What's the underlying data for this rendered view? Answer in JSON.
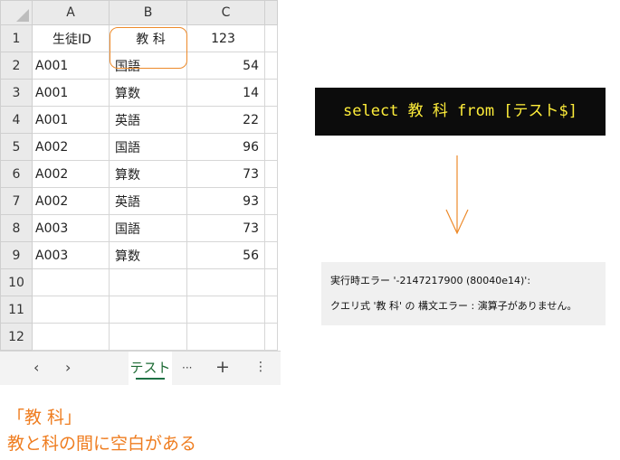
{
  "spreadsheet": {
    "columns": [
      "A",
      "B",
      "C"
    ],
    "rows": [
      {
        "num": "1",
        "a": "生徒ID",
        "b": "教 科",
        "c": "123"
      },
      {
        "num": "2",
        "a": "A001",
        "b": "国語",
        "c": "54"
      },
      {
        "num": "3",
        "a": "A001",
        "b": "算数",
        "c": "14"
      },
      {
        "num": "4",
        "a": "A001",
        "b": "英語",
        "c": "22"
      },
      {
        "num": "5",
        "a": "A002",
        "b": "国語",
        "c": "96"
      },
      {
        "num": "6",
        "a": "A002",
        "b": "算数",
        "c": "73"
      },
      {
        "num": "7",
        "a": "A002",
        "b": "英語",
        "c": "93"
      },
      {
        "num": "8",
        "a": "A003",
        "b": "国語",
        "c": "73"
      },
      {
        "num": "9",
        "a": "A003",
        "b": "算数",
        "c": "56"
      },
      {
        "num": "10",
        "a": "",
        "b": "",
        "c": ""
      },
      {
        "num": "11",
        "a": "",
        "b": "",
        "c": ""
      },
      {
        "num": "12",
        "a": "",
        "b": "",
        "c": ""
      }
    ],
    "tabbar": {
      "prev": "‹",
      "next": "›",
      "sheet_tab": "テスト",
      "more": "···",
      "add": "+",
      "options": "⋮"
    }
  },
  "sql": {
    "query": "select 教 科 from [テスト$]"
  },
  "error": {
    "line1": "実行時エラー '-2147217900 (80040e14)':",
    "line2": "クエリ式 '教 科' の 構文エラー : 演算子がありません。"
  },
  "caption": {
    "line1": "「教 科」",
    "line2": "教と科の間に空白がある"
  },
  "colors": {
    "highlight": "#ed8a2a",
    "caption": "#ef7d20",
    "sql_bg": "#0c0c0c",
    "sql_text": "#ffee3a",
    "sheet_tab_text": "#1e6b35"
  }
}
